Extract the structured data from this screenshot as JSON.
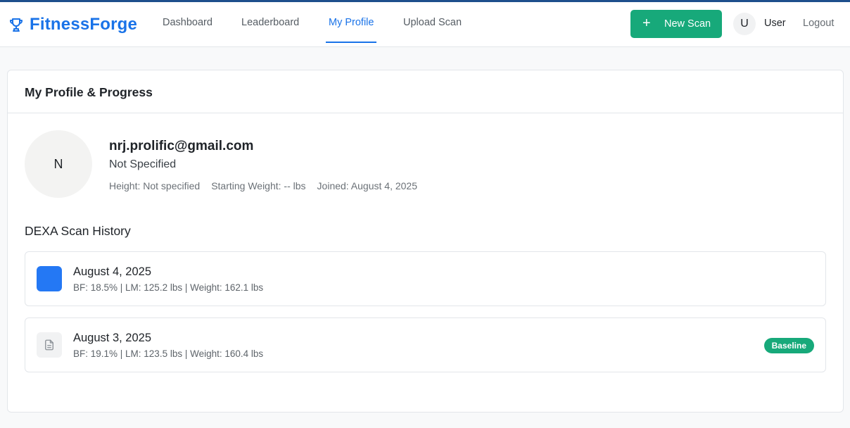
{
  "app": {
    "name": "FitnessForge",
    "brand_color": "#1a73e8",
    "icon": "trophy-icon"
  },
  "nav": {
    "items": [
      {
        "label": "Dashboard"
      },
      {
        "label": "Leaderboard"
      },
      {
        "label": "My Profile",
        "active": true
      },
      {
        "label": "Upload Scan"
      }
    ]
  },
  "header_actions": {
    "new_scan_label": "New Scan",
    "new_scan_icon": "plus-icon",
    "new_scan_color": "#17a97a",
    "user_initial": "U",
    "user_name": "User",
    "logout_label": "Logout"
  },
  "profile": {
    "card_title": "My Profile & Progress",
    "avatar_initial": "N",
    "email": "nrj.prolific@gmail.com",
    "subtitle": "Not Specified",
    "height": "Height: Not specified",
    "starting_weight": "Starting Weight: -- lbs",
    "joined": "Joined: August 4, 2025"
  },
  "scan_history": {
    "title": "DEXA Scan History",
    "scans": [
      {
        "date": "August 4, 2025",
        "stats": "BF: 18.5% | LM: 125.2 lbs | Weight: 162.1 lbs",
        "icon": "blue-square-icon",
        "badge": ""
      },
      {
        "date": "August 3, 2025",
        "stats": "BF: 19.1% | LM: 123.5 lbs | Weight: 160.4 lbs",
        "icon": "document-icon",
        "badge": "Baseline"
      }
    ]
  }
}
